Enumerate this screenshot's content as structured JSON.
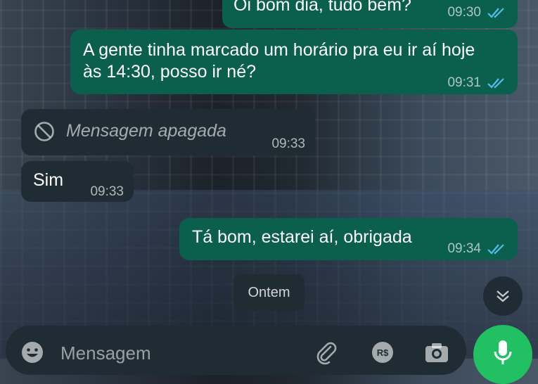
{
  "colors": {
    "outgoing_bubble": "#0b5f4d",
    "incoming_bubble": "#1f2c34",
    "read_ticks": "#53bdeb",
    "mic_button": "#21c063"
  },
  "messages": [
    {
      "direction": "outgoing",
      "text": "Oi bom dia, tudo bem?",
      "time": "09:30",
      "status_icon": "double-check-read-icon"
    },
    {
      "direction": "outgoing",
      "text": "A gente tinha marcado um horário pra eu ir  aí hoje  às 14:30, posso ir né?",
      "time": "09:31",
      "status_icon": "double-check-read-icon"
    },
    {
      "direction": "incoming",
      "text": "Mensagem apagada",
      "time": "09:33",
      "icon": "deleted-message-icon"
    },
    {
      "direction": "incoming",
      "text": "Sim",
      "time": "09:33"
    },
    {
      "direction": "outgoing",
      "text": "Tá bom, estarei aí, obrigada",
      "time": "09:34",
      "status_icon": "double-check-read-icon"
    }
  ],
  "date_separator": "Ontem",
  "composer": {
    "placeholder": "Mensagem",
    "icons": [
      "emoji-icon",
      "attach-icon",
      "payment-icon",
      "camera-icon"
    ]
  },
  "buttons": {
    "scroll_down_icon": "double-chevron-down-icon",
    "mic_icon": "microphone-icon"
  }
}
